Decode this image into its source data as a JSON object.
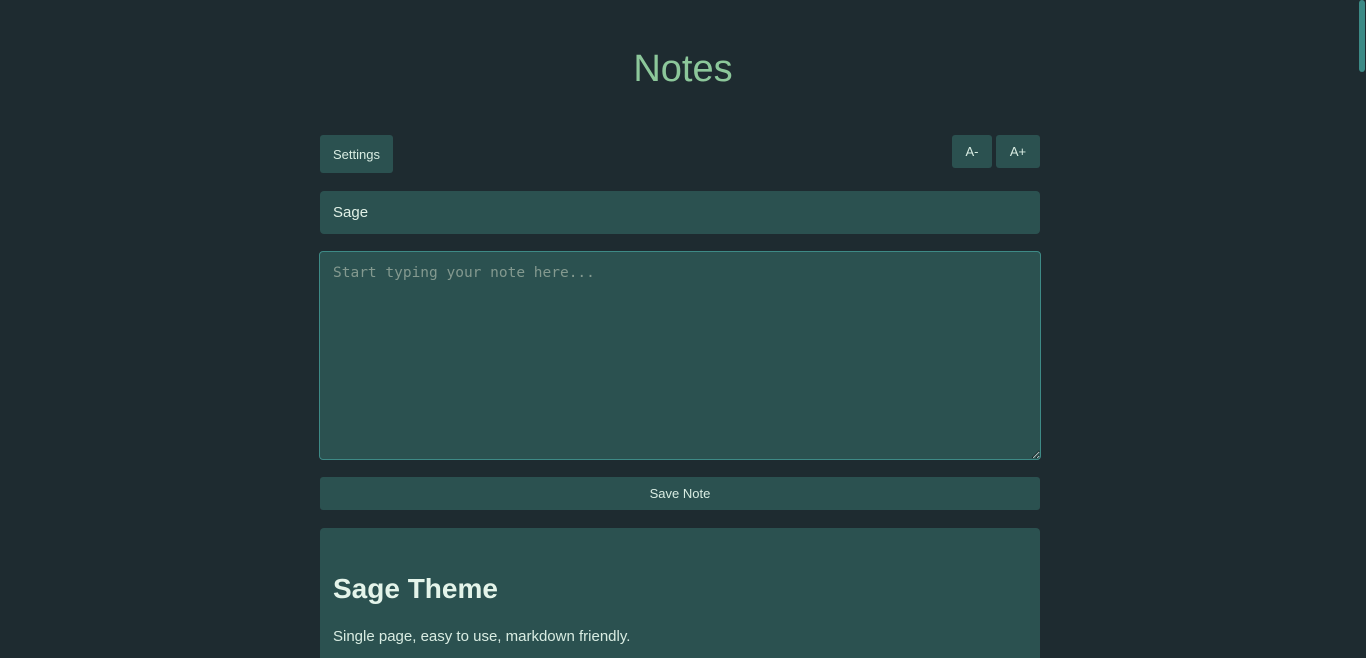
{
  "header": {
    "title": "Notes"
  },
  "toolbar": {
    "settings_label": "Settings",
    "font_decrease_label": "A-",
    "font_increase_label": "A+"
  },
  "editor": {
    "title_value": "Sage",
    "note_placeholder": "Start typing your note here...",
    "save_label": "Save Note"
  },
  "preview": {
    "heading": "Sage Theme",
    "body": "Single page, easy to use, markdown friendly."
  },
  "colors": {
    "background": "#1e2b30",
    "panel": "#2b5150",
    "accent": "#8cc79a",
    "focus_border": "#3e8a86"
  }
}
